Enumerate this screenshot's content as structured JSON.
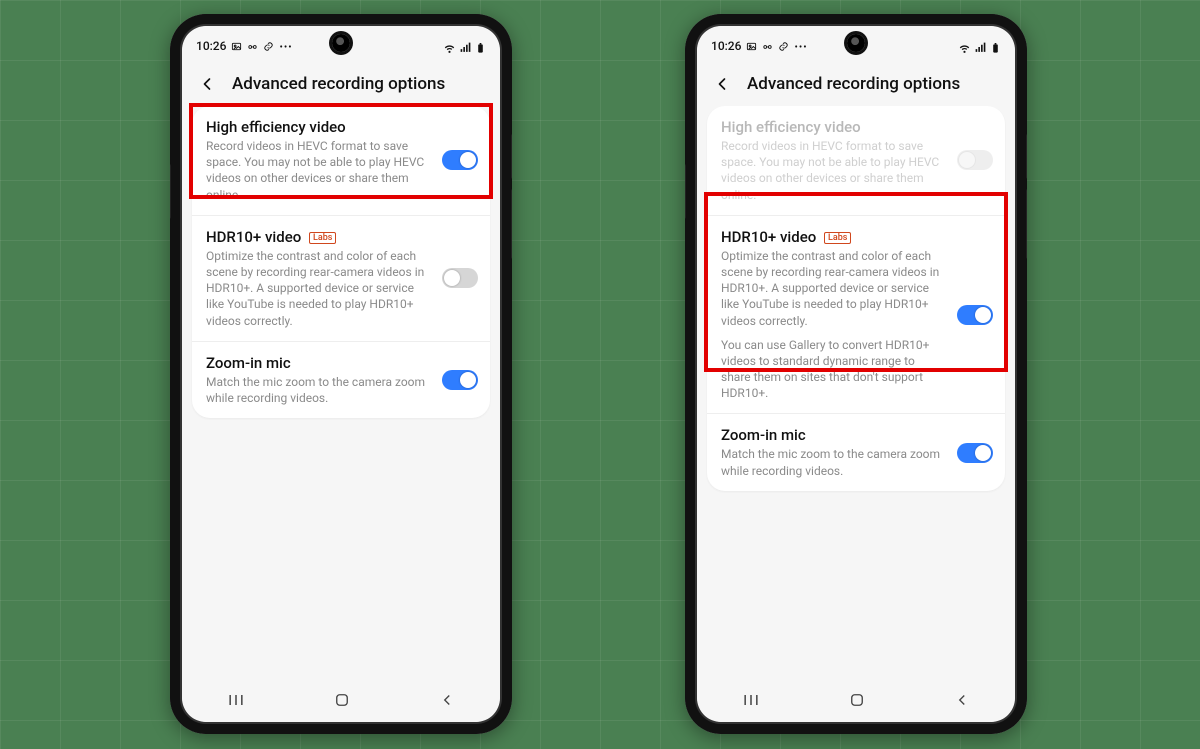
{
  "status": {
    "time": "10:26"
  },
  "header": {
    "title": "Advanced recording options"
  },
  "labs_badge": "Labs",
  "phones": [
    {
      "highlight_index": 0,
      "settings": [
        {
          "key": "hevc",
          "title": "High efficiency video",
          "desc": "Record videos in HEVC format to save space. You may not be able to play HEVC videos on other devices or share them online.",
          "on": true,
          "disabled": false,
          "badge": false
        },
        {
          "key": "hdr10",
          "title": "HDR10+ video",
          "desc": "Optimize the contrast and color of each scene by recording rear-camera videos in HDR10+. A supported device or service like YouTube is needed to play HDR10+ videos correctly.",
          "on": false,
          "disabled": false,
          "badge": true
        },
        {
          "key": "zoom",
          "title": "Zoom-in mic",
          "desc": "Match the mic zoom to the camera zoom while recording videos.",
          "on": true,
          "disabled": false,
          "badge": false
        }
      ]
    },
    {
      "highlight_index": 1,
      "settings": [
        {
          "key": "hevc",
          "title": "High efficiency video",
          "desc": "Record videos in HEVC format to save space. You may not be able to play HEVC videos on other devices or share them online.",
          "on": false,
          "disabled": true,
          "badge": false
        },
        {
          "key": "hdr10",
          "title": "HDR10+ video",
          "desc": "Optimize the contrast and color of each scene by recording rear-camera videos in HDR10+. A supported device or service like YouTube is needed to play HDR10+ videos correctly.",
          "desc2": "You can use Gallery to convert HDR10+ videos to standard dynamic range to share them on sites that don't support HDR10+.",
          "on": true,
          "disabled": false,
          "badge": true
        },
        {
          "key": "zoom",
          "title": "Zoom-in mic",
          "desc": "Match the mic zoom to the camera zoom while recording videos.",
          "on": true,
          "disabled": false,
          "badge": false
        }
      ]
    }
  ]
}
